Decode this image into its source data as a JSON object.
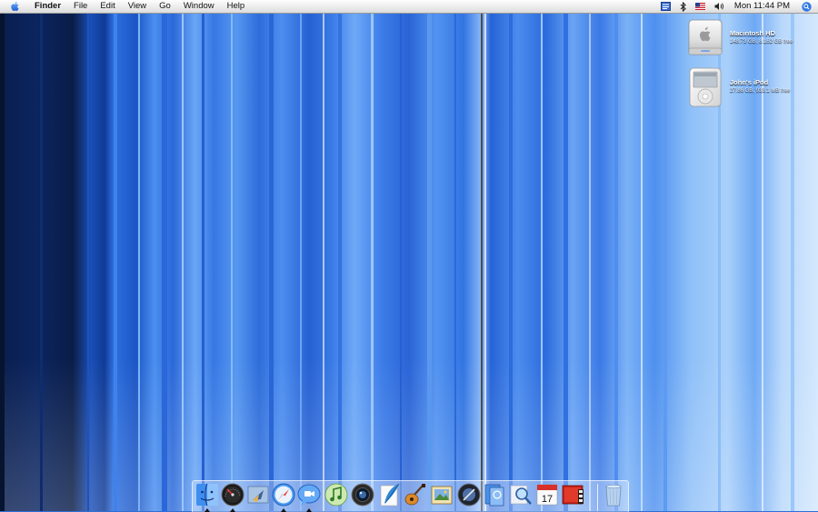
{
  "menubar": {
    "apple_icon": "apple-logo-icon",
    "app_name": "Finder",
    "menus": [
      "File",
      "Edit",
      "View",
      "Go",
      "Window",
      "Help"
    ],
    "status_icons": [
      "script-menu-icon",
      "bluetooth-icon",
      "us-flag-input-icon",
      "volume-icon"
    ],
    "clock": "Mon 11:44 PM",
    "spotlight_icon": "spotlight-search-icon"
  },
  "desktop": {
    "icons": [
      {
        "name": "Macintosh HD",
        "info": "148.73 GB, 8.162 GB free",
        "icon": "hard-drive-icon"
      },
      {
        "name": "John's iPod",
        "info": "27.86 GB, 933.1 MB free",
        "icon": "ipod-icon"
      }
    ]
  },
  "dock": {
    "items": [
      {
        "id": "finder",
        "icon": "finder-icon",
        "running": true
      },
      {
        "id": "dashboard",
        "icon": "dashboard-icon",
        "running": true
      },
      {
        "id": "mail",
        "icon": "mail-icon",
        "running": false
      },
      {
        "id": "safari",
        "icon": "safari-icon",
        "running": true
      },
      {
        "id": "ichat",
        "icon": "ichat-icon",
        "running": true
      },
      {
        "id": "itunes",
        "icon": "itunes-icon",
        "running": false
      },
      {
        "id": "iphoto-camera",
        "icon": "camera-lens-icon",
        "running": false
      },
      {
        "id": "iweb",
        "icon": "quill-icon",
        "running": false
      },
      {
        "id": "garageband",
        "icon": "guitar-icon",
        "running": false
      },
      {
        "id": "iphoto",
        "icon": "photo-icon",
        "running": false
      },
      {
        "id": "aperture",
        "icon": "aperture-icon",
        "running": false
      },
      {
        "id": "preview",
        "icon": "preview-icon",
        "running": false
      },
      {
        "id": "search",
        "icon": "magnifier-icon",
        "running": false
      },
      {
        "id": "ical",
        "icon": "calendar-icon",
        "running": false,
        "label": "17"
      },
      {
        "id": "dvd",
        "icon": "film-icon",
        "running": false
      },
      {
        "id": "trash",
        "icon": "trash-icon",
        "running": false
      }
    ]
  },
  "colors": {
    "wallpaper_accent": "#2f6fd6",
    "menubar": "#ececec"
  }
}
